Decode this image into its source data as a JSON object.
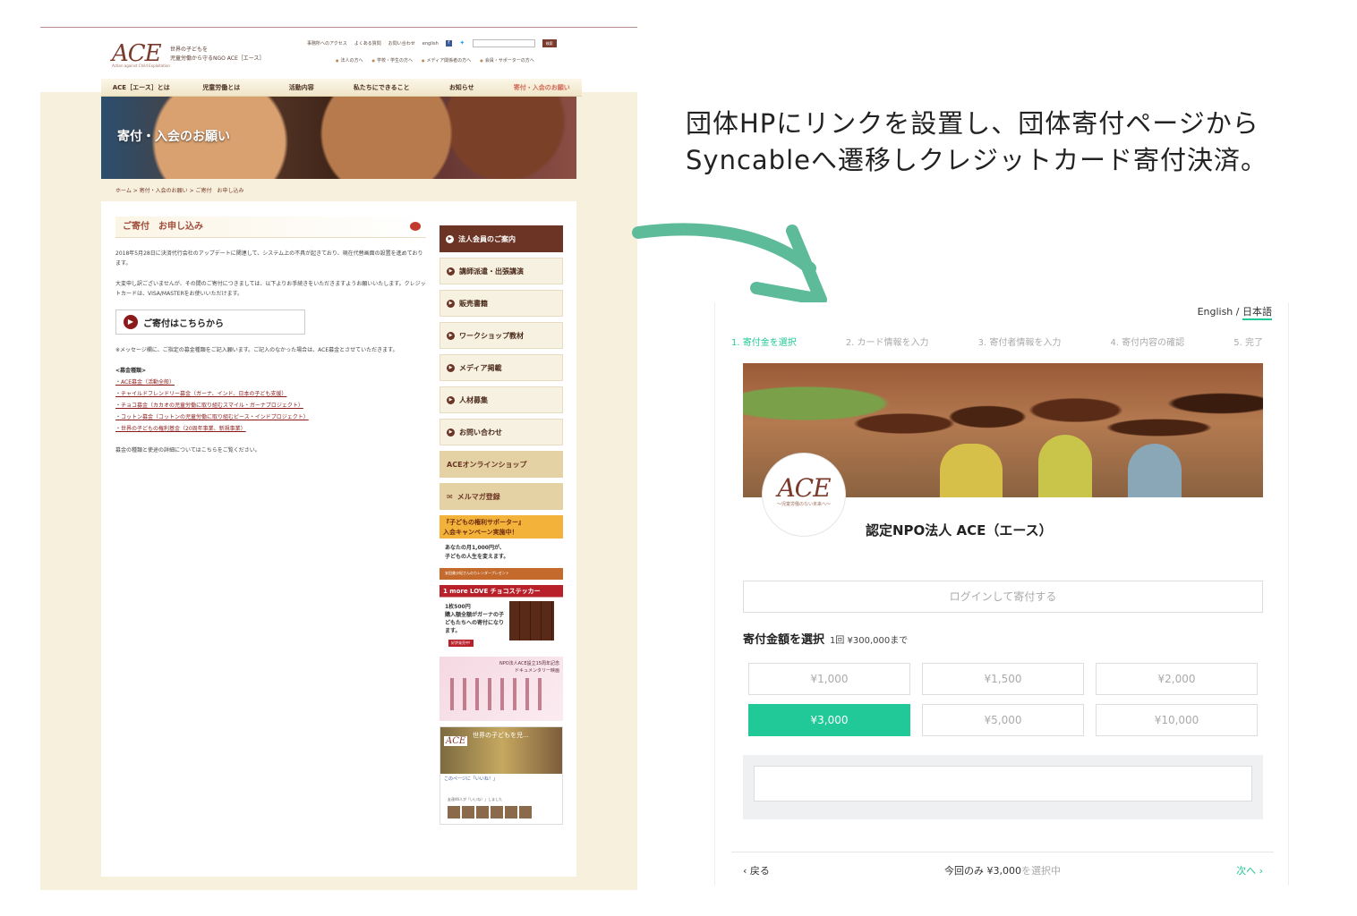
{
  "caption": {
    "line1": "団体HPにリンクを設置し、団体寄付ページから",
    "line2": "Syncableへ遷移しクレジットカード寄付決済。"
  },
  "ace_site": {
    "logo": "ACE",
    "logo_sub": "Action against Child Exploitation",
    "tagline": "世界の子どもを\n児童労働から守るNGO ACE［エース］",
    "util_links": [
      "事務所へのアクセス",
      "よくある質問",
      "お問い合わせ",
      "english"
    ],
    "search_button": "検索",
    "audience_links": [
      "法人の方へ",
      "学校・学生の方へ",
      "メディア関係者の方へ",
      "会員・サポーターの方へ"
    ],
    "nav": [
      "ACE［エース］とは",
      "児童労働とは",
      "活動内容",
      "私たちにできること",
      "お知らせ",
      "寄付・入会のお願い"
    ],
    "hero_title": "寄付・入会のお願い",
    "breadcrumb": "ホーム > 寄付・入会のお願い > ご寄付　お申し込み",
    "section_title": "ご寄付　お申し込み",
    "para1": "2018年5月28日に決済代行会社のアップデートに関連して、システム上の不具が起きており、現在代替画面の設置を進めております。",
    "para2": "大変申し訳ございませんが、その間のご寄付につきましては、以下よりお手続きをいただきますようお願いいたします。クレジットカードは、VISA/MASTERをお使いいただけます。",
    "donate_button": "ご寄付はこちらから",
    "para3": "※メッセージ欄に、ご指定の募金種類をご記入願います。ご記入のなかった場合は、ACE募金とさせていただきます。",
    "fund_heading": "<募金種類>",
    "funds": [
      "ACE募金（活動全般）",
      "チャイルドフレンドリー募金（ガーナ、インド、日本の子ども支援）",
      "チョコ募金（カカオの児童労働に取り組むスマイル・ガーナプロジェクト）",
      "コットン募金（コットンの児童労働に取り組むピース・インドプロジェクト）",
      "世界の子どもの権利基金（20周年事業、新規事業）"
    ],
    "para4": "募金の種類と使途の詳細についてはこちらをご覧ください。",
    "sidebar": [
      "法人会員のご案内",
      "講師派遣・出張講演",
      "販売書籍",
      "ワークショップ教材",
      "メディア掲載",
      "人材募集",
      "お問い合わせ"
    ],
    "shop_button": "ACEオンラインショップ",
    "mail_button": "メルマガ登録",
    "banner1": {
      "title": "『子どもの権利サポーター』\n入会キャンペーン実施中！",
      "body": "あなたの月1,000円が、\n子どもの人生を変えます。",
      "foot": "安田美沙紀さんのカレンダープレゼント"
    },
    "banner2": {
      "title": "1 more LOVE チョコステッカー",
      "body": "1枚500円\n購入額全額がガーナの子どもたちへの寄付になります。",
      "foot": "好評発売中!"
    },
    "banner3": {
      "title": "NPO法人ACE設立15周年記念\nドキュメンタリー映画"
    },
    "banner4": {
      "title": "世界の子どもを児…",
      "like": "このページに「いいね！」",
      "fans": "友達46人が「いいね！」しました"
    }
  },
  "syncable": {
    "lang_en": "English",
    "lang_sep": " / ",
    "lang_ja": "日本語",
    "steps": [
      "1. 寄付金を選択",
      "2. カード情報を入力",
      "3. 寄付者情報を入力",
      "4. 寄付内容の確認",
      "5. 完了"
    ],
    "active_step": 0,
    "org_logo": "ACE",
    "org_logo_sub": "〜児童労働のない未来へ〜",
    "org_name": "認定NPO法人 ACE（エース）",
    "login_button": "ログインして寄付する",
    "amount_title": "寄付金額を選択",
    "amount_limit": "1回 ¥300,000まで",
    "amounts": [
      "¥1,000",
      "¥1,500",
      "¥2,000",
      "¥3,000",
      "¥5,000",
      "¥10,000"
    ],
    "selected_amount_index": 3,
    "back": "戻る",
    "summary_prefix": "今回のみ ¥3,000",
    "summary_suffix": "を選択中",
    "next": "次へ",
    "accent_color": "#20c997"
  }
}
